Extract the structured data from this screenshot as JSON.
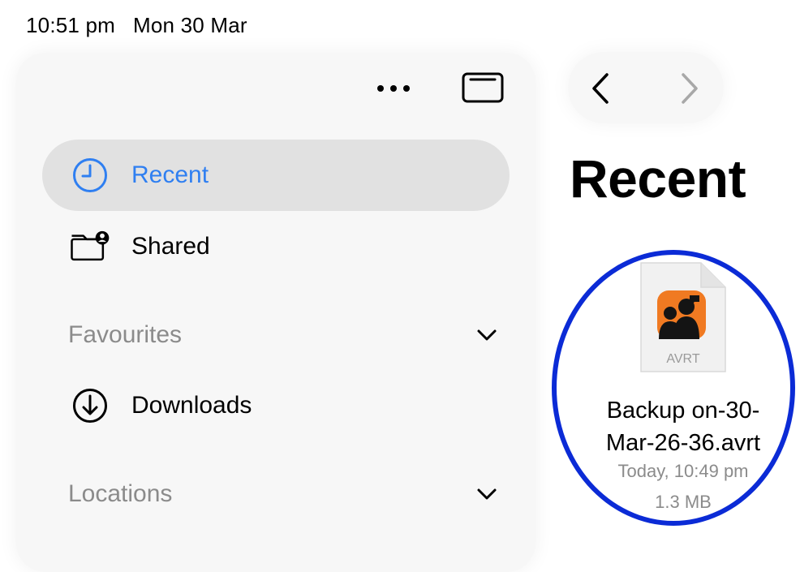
{
  "status_bar": {
    "time": "10:51 pm",
    "date": "Mon 30 Mar"
  },
  "sidebar": {
    "more_icon": "ellipsis-icon",
    "toggle_icon": "sidebar-toggle-icon",
    "items": [
      {
        "label": "Recent",
        "icon": "clock-icon",
        "selected": true
      },
      {
        "label": "Shared",
        "icon": "shared-folder-icon",
        "selected": false
      }
    ],
    "sections": [
      {
        "label": "Favourites",
        "items": [
          {
            "label": "Downloads",
            "icon": "download-icon"
          }
        ]
      },
      {
        "label": "Locations"
      }
    ],
    "accent_color": "#2f7ff1"
  },
  "navigation": {
    "back_icon": "chevron-left-icon",
    "forward_icon": "chevron-right-icon"
  },
  "main": {
    "title": "Recent",
    "files": [
      {
        "name": "Backup on-30-Mar-26-36.avrt",
        "name_line1": "Backup on-30-",
        "name_line2": "Mar-26-36.avrt",
        "modified": "Today, 10:49 pm",
        "size": "1.3 MB",
        "type_label": "AVRT",
        "icon": "avrt-file-icon"
      }
    ]
  },
  "highlight_color": "#0b2bd6"
}
